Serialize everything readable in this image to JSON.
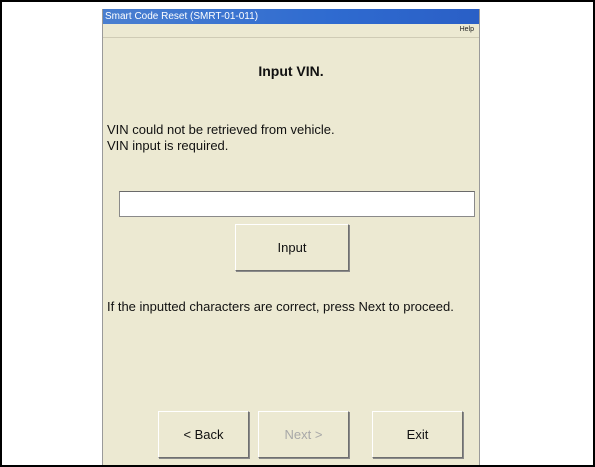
{
  "window": {
    "title": "Smart Code Reset (SMRT-01-011)",
    "menu_help": "Help"
  },
  "main": {
    "heading": "Input VIN.",
    "message_line1": "VIN could not be retrieved from vehicle.",
    "message_line2": "VIN input is required.",
    "vin_value": "",
    "input_button": "Input",
    "instruction": "If the inputted characters are correct, press Next to proceed."
  },
  "footer": {
    "back_label": "< Back",
    "next_label": "Next >",
    "exit_label": "Exit",
    "next_enabled": false
  }
}
